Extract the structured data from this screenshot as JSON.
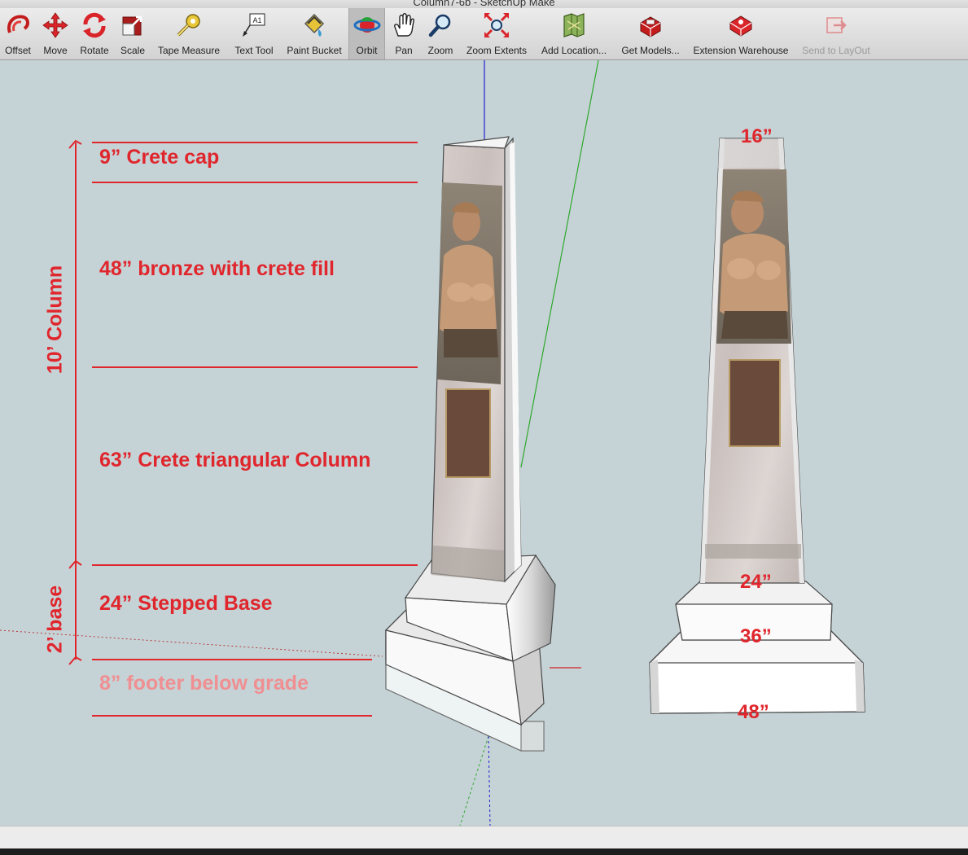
{
  "window": {
    "title": "Column7-6b - SketchUp Make"
  },
  "toolbar": {
    "tools": [
      {
        "id": "offset",
        "label": "Offset",
        "icon": "offset-icon"
      },
      {
        "id": "move",
        "label": "Move",
        "icon": "move-icon"
      },
      {
        "id": "rotate",
        "label": "Rotate",
        "icon": "rotate-icon"
      },
      {
        "id": "scale",
        "label": "Scale",
        "icon": "scale-icon"
      },
      {
        "id": "tape",
        "label": "Tape Measure",
        "icon": "tape-measure-icon"
      },
      {
        "id": "text",
        "label": "Text Tool",
        "icon": "text-tool-icon",
        "glyph": "A1"
      },
      {
        "id": "paint",
        "label": "Paint Bucket",
        "icon": "paint-bucket-icon"
      },
      {
        "id": "orbit",
        "label": "Orbit",
        "icon": "orbit-icon",
        "active": true
      },
      {
        "id": "pan",
        "label": "Pan",
        "icon": "pan-hand-icon"
      },
      {
        "id": "zoom",
        "label": "Zoom",
        "icon": "zoom-magnifier-icon"
      },
      {
        "id": "zoomext",
        "label": "Zoom Extents",
        "icon": "zoom-extents-icon"
      },
      {
        "id": "addloc",
        "label": "Add Location...",
        "icon": "add-location-icon"
      },
      {
        "id": "getmodels",
        "label": "Get Models...",
        "icon": "get-models-icon"
      },
      {
        "id": "extwh",
        "label": "Extension Warehouse",
        "icon": "extension-warehouse-icon"
      },
      {
        "id": "layout",
        "label": "Send to LayOut",
        "icon": "send-to-layout-icon",
        "disabled": true
      }
    ]
  },
  "annotations": {
    "cap": "9”  Crete cap",
    "bronze": "48” bronze with crete fill",
    "triangular": "63” Crete triangular Column",
    "stepped_base": "24” Stepped Base",
    "footer": "8” footer below grade",
    "column_height": "10’ Column",
    "base_height": "2’ base"
  },
  "dimensions": {
    "top": "16”",
    "step_upper": "24”",
    "step_middle": "36”",
    "base_bottom": "48”"
  },
  "colors": {
    "annotation_red": "#e0262d",
    "annotation_faded": "#ef8f92",
    "viewport_bg": "#c6d3d6"
  }
}
